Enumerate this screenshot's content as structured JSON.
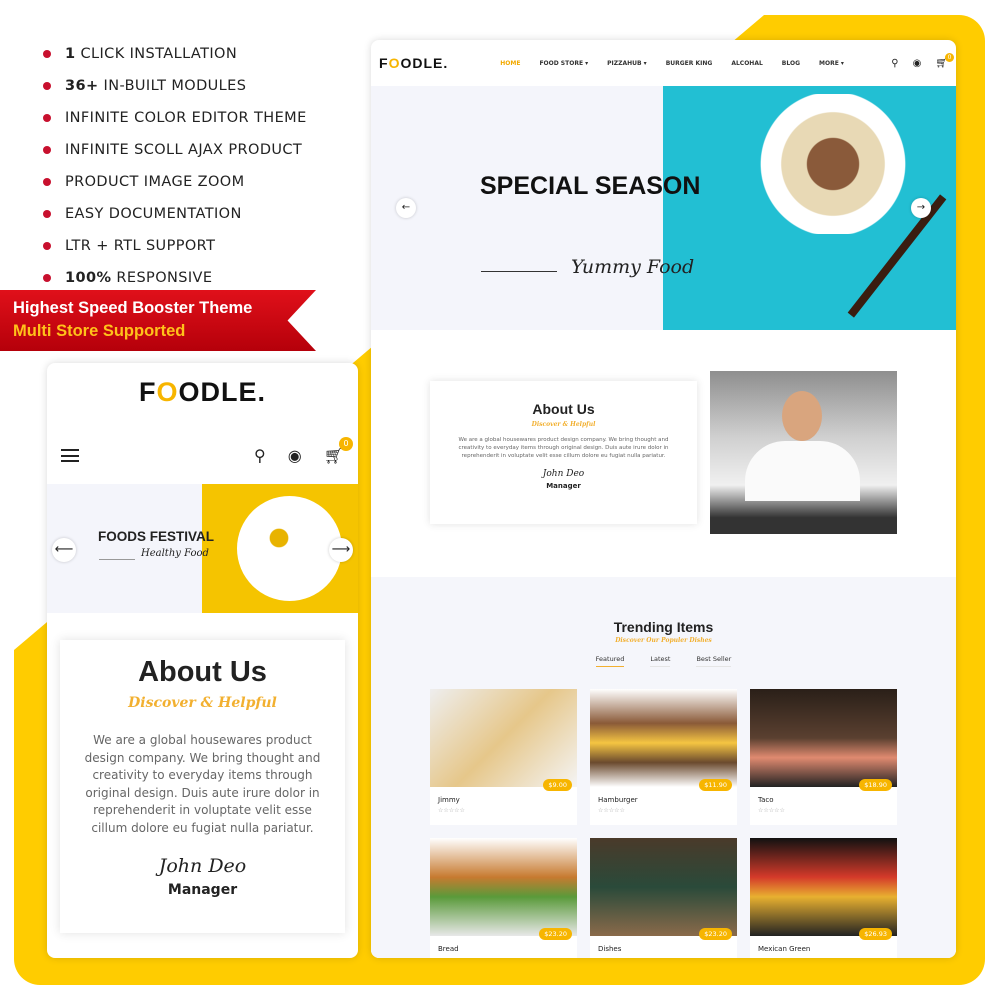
{
  "features": [
    {
      "bold": "1",
      "text": "CLICK INSTALLATION"
    },
    {
      "bold": "36+",
      "text": "IN-BUILT MODULES"
    },
    {
      "bold": "",
      "text": "INFINITE COLOR EDITOR THEME"
    },
    {
      "bold": "",
      "text": "INFINITE SCOLL AJAX PRODUCT"
    },
    {
      "bold": "",
      "text": "PRODUCT IMAGE ZOOM"
    },
    {
      "bold": "",
      "text": "EASY DOCUMENTATION"
    },
    {
      "bold": "",
      "text": "LTR + RTL SUPPORT"
    },
    {
      "bold": "100%",
      "text": "RESPONSIVE"
    }
  ],
  "ribbon": {
    "line1": "Highest Speed Booster Theme",
    "line2": "Multi Store Supported"
  },
  "colors": {
    "accent": "#f7b500",
    "ribbon": "#d0000f",
    "hero_bg": "#22bfd3",
    "yellow_bg": "#ffcc00"
  },
  "logo": {
    "pre": "F",
    "o": "O",
    "post": "ODLE."
  },
  "desktop": {
    "nav": [
      "HOME",
      "FOOD STORE ▾",
      "PIZZAHUB ▾",
      "BURGER KING",
      "ALCOHAL",
      "BLOG",
      "MORE ▾"
    ],
    "cart_count": "0",
    "hero": {
      "title": "SPECIAL SEASON",
      "script": "Yummy Food",
      "prev": "←",
      "next": "→"
    },
    "about": {
      "title": "About Us",
      "subtitle": "Discover & Helpful",
      "text": "We are a global housewares product design company. We bring thought and creativity to everyday items through original design. Duis aute irure dolor in reprehenderit in voluptate velit esse cillum dolore eu fugiat nulla pariatur.",
      "signature": "John Deo",
      "role": "Manager"
    },
    "trending": {
      "title": "Trending Items",
      "subtitle": "Discover Our Populer Dishes",
      "tabs": [
        "Featured",
        "Latest",
        "Best Seller"
      ],
      "products": [
        {
          "name": "Jimmy",
          "price": "$9.00",
          "stars": "☆☆☆☆☆"
        },
        {
          "name": "Hamburger",
          "price": "$11.90",
          "stars": "☆☆☆☆☆"
        },
        {
          "name": "Taco",
          "price": "$18.90",
          "stars": "☆☆☆☆☆"
        },
        {
          "name": "Bread",
          "price": "$23.20",
          "stars": ""
        },
        {
          "name": "Dishes",
          "price": "$23.20",
          "stars": ""
        },
        {
          "name": "Mexican Green",
          "price": "$26.93",
          "stars": ""
        }
      ]
    }
  },
  "mobile": {
    "cart_count": "0",
    "hero": {
      "title": "FOODS FESTIVAL",
      "script": "Healthy Food",
      "prev": "⟵",
      "next": "⟶"
    },
    "about": {
      "title": "About Us",
      "subtitle": "Discover & Helpful",
      "text": "We are a global housewares product design company. We bring thought and creativity to everyday items through original design. Duis aute irure dolor in reprehenderit in voluptate velit esse cillum dolore eu fugiat nulla pariatur.",
      "signature": "John Deo",
      "role": "Manager"
    }
  }
}
